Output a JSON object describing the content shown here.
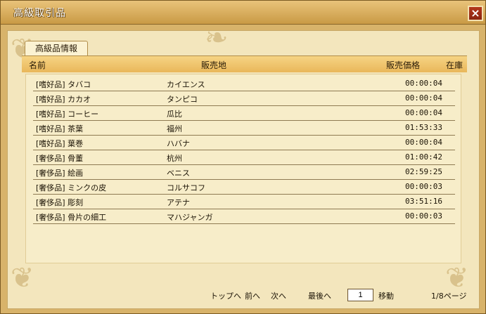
{
  "window": {
    "title": "高級取引品",
    "close_label": "×"
  },
  "tab": {
    "label": "高級品情報"
  },
  "columns": {
    "name": "名前",
    "place": "販売地",
    "price": "販売価格",
    "stock": "在庫"
  },
  "rows": [
    {
      "item": "[嗜好品] タバコ",
      "place": "カイエンス",
      "value": "00:00:04"
    },
    {
      "item": "[嗜好品] カカオ",
      "place": "タンピコ",
      "value": "00:00:04"
    },
    {
      "item": "[嗜好品] コーヒー",
      "place": "瓜比",
      "value": "00:00:04"
    },
    {
      "item": "[嗜好品] 茶葉",
      "place": "福州",
      "value": "01:53:33"
    },
    {
      "item": "[嗜好品] 葉巻",
      "place": "ハバナ",
      "value": "00:00:04"
    },
    {
      "item": "[奢侈品] 骨董",
      "place": "杭州",
      "value": "01:00:42"
    },
    {
      "item": "[奢侈品] 絵画",
      "place": "ベニス",
      "value": "02:59:25"
    },
    {
      "item": "[奢侈品] ミンクの皮",
      "place": "コルサコフ",
      "value": "00:00:03"
    },
    {
      "item": "[奢侈品] 彫刻",
      "place": "アテナ",
      "value": "03:51:16"
    },
    {
      "item": "[奢侈品] 骨片の細工",
      "place": "マハジャンガ",
      "value": "00:00:03"
    }
  ],
  "pagination": {
    "top": "トップへ",
    "prev": "前へ",
    "next": "次へ",
    "last": "最後へ",
    "page_value": "1",
    "go": "移動",
    "page_info": "1/8ページ"
  }
}
